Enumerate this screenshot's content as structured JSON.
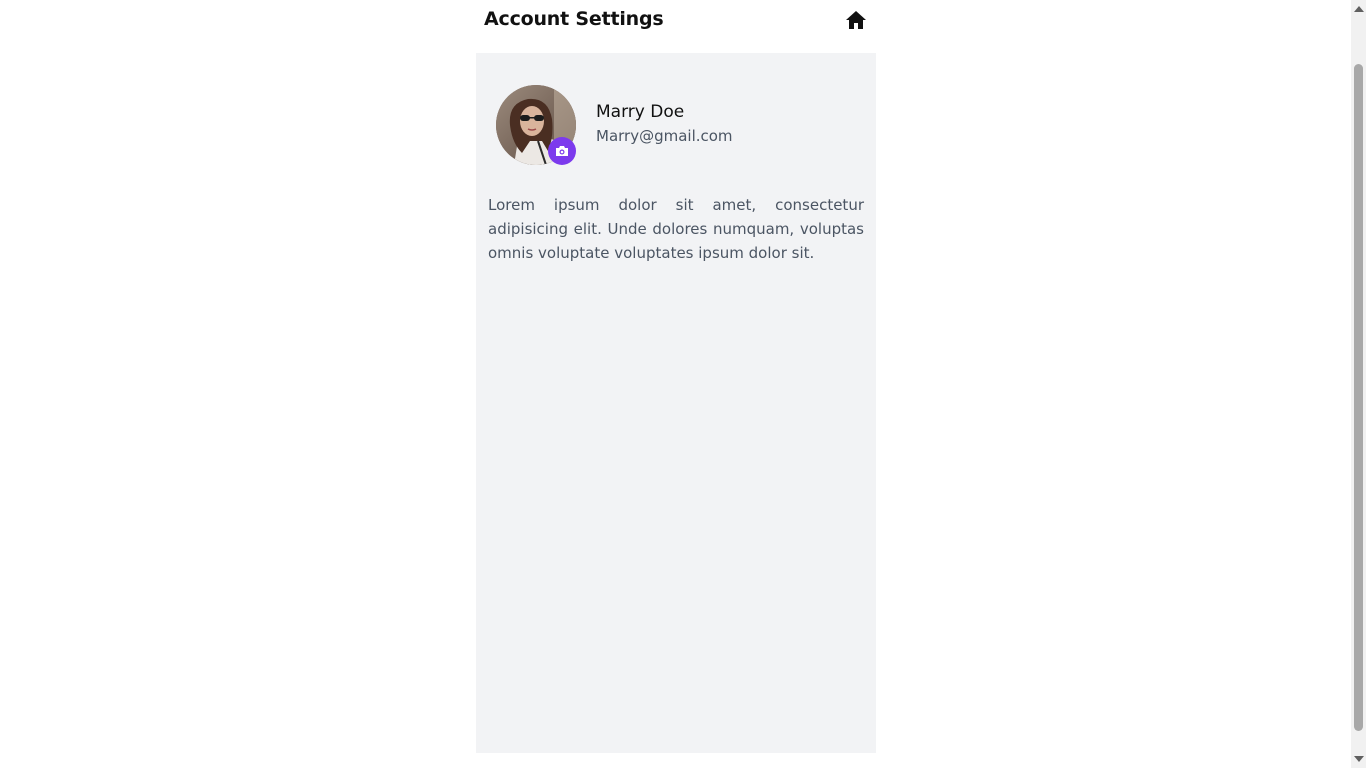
{
  "header": {
    "title": "Account Settings",
    "home_icon": "home-icon"
  },
  "profile": {
    "name": "Marry Doe",
    "email": "Marry@gmail.com",
    "camera_icon": "camera-icon"
  },
  "bio": "Lorem ipsum dolor sit amet, consectetur adipisicing elit. Unde dolores numquam, voluptas omnis voluptate voluptates ipsum dolor sit.",
  "colors": {
    "accent": "#7c3aed",
    "panel_bg": "#f2f3f5",
    "text_muted": "#4b5563"
  }
}
